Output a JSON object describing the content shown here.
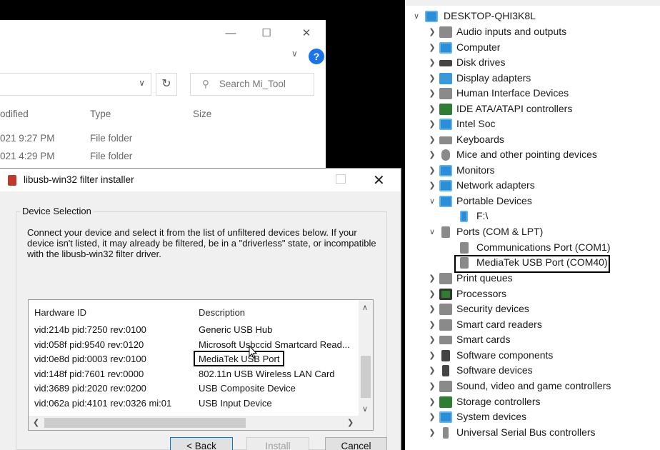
{
  "explorer": {
    "search_placeholder": "Search Mi_Tool",
    "columns": [
      "odified",
      "Type",
      "Size"
    ],
    "rows": [
      {
        "date": "021 9:27 PM",
        "type": "File folder"
      },
      {
        "date": "021 4:29 PM",
        "type": "File folder"
      }
    ],
    "help_label": "?"
  },
  "dialog": {
    "title": "libusb-win32 filter installer",
    "group_label": "Device Selection",
    "instructions": "Connect your device and select it from the list of unfiltered devices below. If your device isn't listed, it may already be filtered, be in a \"driverless\" state, or incompatible with the libusb-win32 filter driver.",
    "list_headers": {
      "hardware_id": "Hardware ID",
      "description": "Description"
    },
    "devices": [
      {
        "id": "vid:214b pid:7250 rev:0100",
        "desc": "Generic USB Hub"
      },
      {
        "id": "vid:058f pid:9540 rev:0120",
        "desc": "Microsoft Usbccid Smartcard Read..."
      },
      {
        "id": "vid:0e8d pid:0003 rev:0100",
        "desc": "MediaTek USB Port"
      },
      {
        "id": "vid:148f pid:7601 rev:0000",
        "desc": "802.11n USB Wireless LAN Card"
      },
      {
        "id": "vid:3689 pid:2020 rev:0200",
        "desc": "USB Composite Device"
      },
      {
        "id": "vid:062a pid:4101 rev:0326 mi:01",
        "desc": "USB Input Device"
      }
    ],
    "buttons": {
      "back": "< Back",
      "install": "Install",
      "cancel": "Cancel"
    }
  },
  "device_manager": {
    "root": "DESKTOP-QHI3K8L",
    "categories": [
      {
        "label": "Audio inputs and outputs",
        "icon": "speaker-icon",
        "expanded": false
      },
      {
        "label": "Computer",
        "icon": "computer-icon",
        "expanded": false
      },
      {
        "label": "Disk drives",
        "icon": "disk-drive-icon",
        "expanded": false
      },
      {
        "label": "Display adapters",
        "icon": "display-adapter-icon",
        "expanded": false
      },
      {
        "label": "Human Interface Devices",
        "icon": "hid-icon",
        "expanded": false
      },
      {
        "label": "IDE ATA/ATAPI controllers",
        "icon": "ide-controller-icon",
        "expanded": false
      },
      {
        "label": "Intel Soc",
        "icon": "monitor-icon",
        "expanded": false
      },
      {
        "label": "Keyboards",
        "icon": "keyboard-icon",
        "expanded": false
      },
      {
        "label": "Mice and other pointing devices",
        "icon": "mouse-icon",
        "expanded": false
      },
      {
        "label": "Monitors",
        "icon": "monitor-icon",
        "expanded": false
      },
      {
        "label": "Network adapters",
        "icon": "network-adapter-icon",
        "expanded": false
      },
      {
        "label": "Portable Devices",
        "icon": "portable-device-icon",
        "expanded": true,
        "children": [
          "F:\\"
        ]
      },
      {
        "label": "Ports (COM & LPT)",
        "icon": "port-icon",
        "expanded": true,
        "children": [
          "Communications Port (COM1)",
          "MediaTek USB Port (COM40)"
        ]
      },
      {
        "label": "Print queues",
        "icon": "printer-icon",
        "expanded": false
      },
      {
        "label": "Processors",
        "icon": "processor-icon",
        "expanded": false
      },
      {
        "label": "Security devices",
        "icon": "security-device-icon",
        "expanded": false
      },
      {
        "label": "Smart card readers",
        "icon": "smart-card-reader-icon",
        "expanded": false
      },
      {
        "label": "Smart cards",
        "icon": "smart-card-icon",
        "expanded": false
      },
      {
        "label": "Software components",
        "icon": "software-component-icon",
        "expanded": false
      },
      {
        "label": "Software devices",
        "icon": "software-device-icon",
        "expanded": false
      },
      {
        "label": "Sound, video and game controllers",
        "icon": "speaker-icon",
        "expanded": false
      },
      {
        "label": "Storage controllers",
        "icon": "storage-controller-icon",
        "expanded": false
      },
      {
        "label": "System devices",
        "icon": "system-device-icon",
        "expanded": false
      },
      {
        "label": "Universal Serial Bus controllers",
        "icon": "usb-icon",
        "expanded": false
      }
    ]
  }
}
